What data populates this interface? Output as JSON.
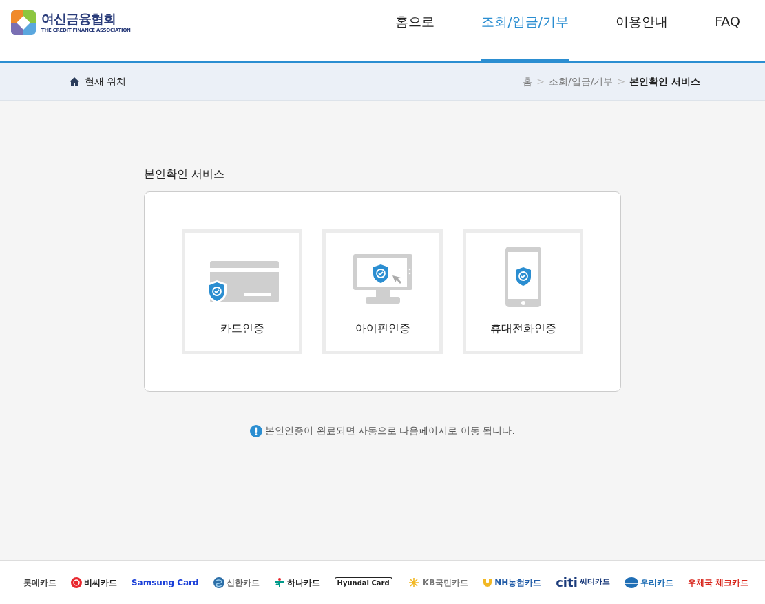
{
  "header": {
    "logo": {
      "name": "여신금융협회",
      "subtitle": "THE CREDIT FINANCE ASSOCIATION"
    },
    "nav": [
      {
        "label": "홈으로",
        "selected": false
      },
      {
        "label": "조회/입금/기부",
        "selected": true
      },
      {
        "label": "이용안내",
        "selected": false
      },
      {
        "label": "FAQ",
        "selected": false
      }
    ]
  },
  "location_bar": {
    "label": "현재 위치",
    "breadcrumb": [
      {
        "label": "홈",
        "current": false
      },
      {
        "label": "조회/입금/기부",
        "current": false
      },
      {
        "label": "본인확인 서비스",
        "current": true
      }
    ],
    "separator": ">"
  },
  "section_title": "본인확인 서비스",
  "auth_options": [
    {
      "kind": "card",
      "label": "카드인증"
    },
    {
      "kind": "ipin",
      "label": "아이핀인증"
    },
    {
      "kind": "phone",
      "label": "휴대전화인증"
    }
  ],
  "notice": "본인인증이 완료되면 자동으로 다음페이지로 이동 됩니다.",
  "footer_logos": [
    {
      "kind": "plain",
      "text": "롯데카드",
      "color": "#444444"
    },
    {
      "kind": "bc",
      "text": "비씨카드",
      "color": "#222222"
    },
    {
      "kind": "plain",
      "text": "Samsung Card",
      "color": "#1a3fd8"
    },
    {
      "kind": "shinhan",
      "text": "신한카드",
      "color": "#666666"
    },
    {
      "kind": "hana",
      "text": "하나카드",
      "color": "#222222"
    },
    {
      "kind": "hyundai",
      "text": "Hyundai Card",
      "color": "#222222"
    },
    {
      "kind": "kb",
      "text": "KB국민카드",
      "color": "#777777"
    },
    {
      "kind": "nh",
      "text": "NH농협카드",
      "color": "#1f5aa6"
    },
    {
      "kind": "citi",
      "text": "citi",
      "sub": "씨티카드",
      "color": "#1a3a7a"
    },
    {
      "kind": "woori",
      "text": "우리카드",
      "color": "#1f6eb5"
    },
    {
      "kind": "plain",
      "text": "우체국 체크카드",
      "color": "#d8261c"
    }
  ]
}
